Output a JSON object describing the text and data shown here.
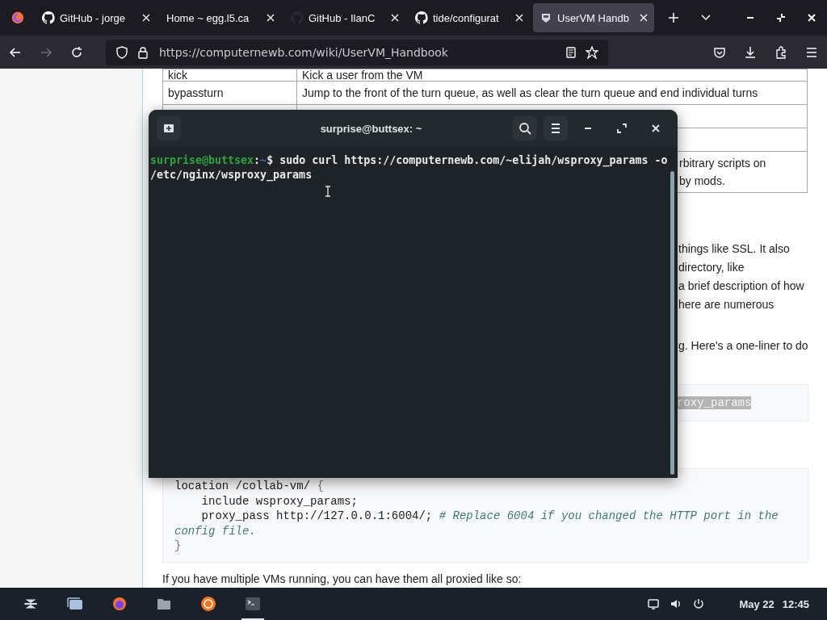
{
  "browser": {
    "tabs": [
      {
        "title": "GitHub - jorge",
        "kind": "github",
        "selected": false
      },
      {
        "title": "Home ~ egg.l5.ca",
        "kind": "none",
        "selected": false
      },
      {
        "title": "GitHub - IlanC",
        "kind": "github-dim",
        "selected": false
      },
      {
        "title": "tide/configurat",
        "kind": "github",
        "selected": false
      },
      {
        "title": "UserVM Handb",
        "kind": "site",
        "selected": true
      }
    ],
    "url": "https://computernewb.com/wiki/UserVM_Handbook"
  },
  "page": {
    "table_rows": [
      {
        "command": "kick",
        "description": "Kick a user from the VM"
      },
      {
        "command": "bypassturn",
        "description": "Jump to the front of the turn queue, as well as clear the turn queue and end individual turns"
      },
      {},
      {},
      {
        "description_lines": [
          "rbitrary scripts on",
          "by mods."
        ]
      }
    ],
    "paragraph_lines": [
      "things like SSL. It also",
      "directory, like",
      "a brief description of how",
      "here are numerous"
    ],
    "paragraph_2": "g. Here's a one-liner to do",
    "code_1": {
      "text": "roxy_params",
      "selected": true
    },
    "code_2": [
      [
        {
          "kind": "plain",
          "text": "location /collab-vm/ "
        },
        {
          "kind": "punct",
          "text": "{"
        }
      ],
      [
        {
          "kind": "plain",
          "text": "    include wsproxy_params;"
        }
      ],
      [
        {
          "kind": "plain",
          "text": "    proxy_pass http://127.0.0.1:6004/; "
        },
        {
          "kind": "comment",
          "text": "# Replace 6004 if you changed the HTTP port in the config file."
        }
      ],
      [
        {
          "kind": "punct",
          "text": "}"
        }
      ]
    ],
    "paragraph_3": "If you have multiple VMs running, you can have them all proxied like so:"
  },
  "terminal": {
    "title": "surprise@buttsex: ~",
    "user": "surprise@buttsex",
    "separator": ":",
    "path": "~",
    "prompt": "$",
    "command": "sudo curl https://computernewb.com/~elijah/wsproxy_params -o /etc/nginx/wsproxy_params"
  },
  "taskbar": {
    "apps": [
      {
        "running": false
      },
      {
        "running": false
      },
      {
        "running": false
      },
      {
        "running": false
      },
      {
        "running": false
      },
      {
        "running": true
      }
    ],
    "date": "May 22",
    "time": "12:45"
  }
}
